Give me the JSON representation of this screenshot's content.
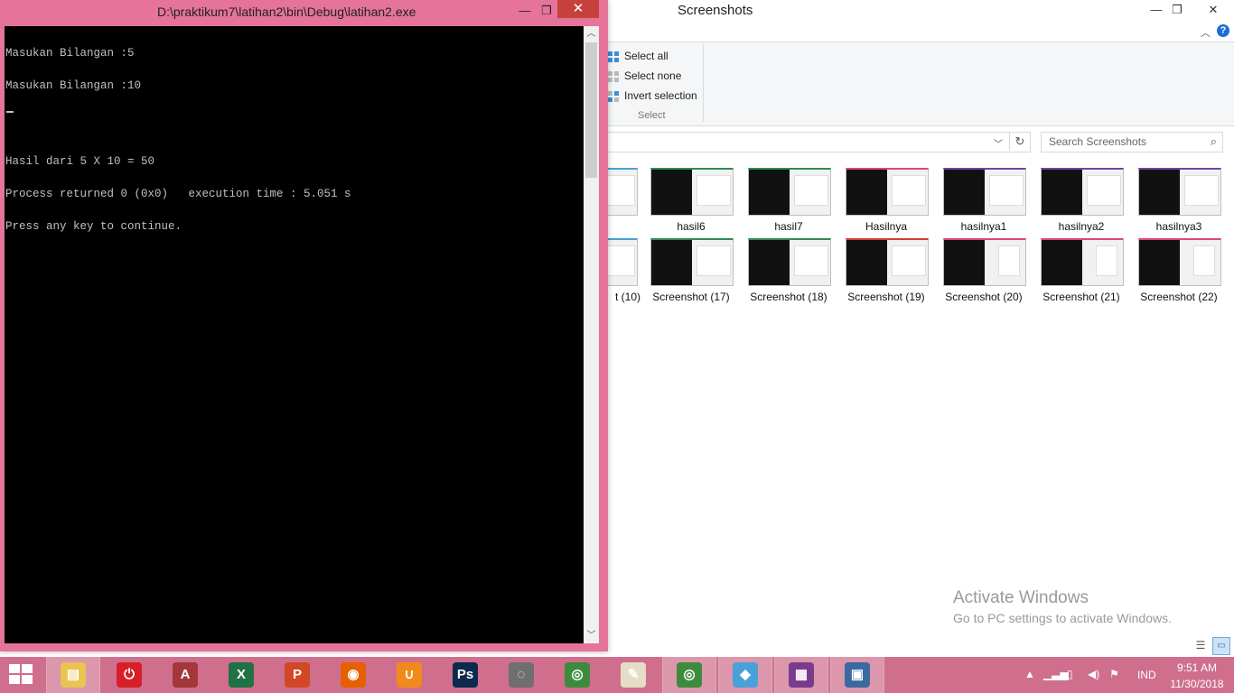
{
  "console": {
    "title": "D:\\praktikum7\\latihan2\\bin\\Debug\\latihan2.exe",
    "minimize": "—",
    "maximize": "❐",
    "close": "✕",
    "lines": [
      "Masukan Bilangan :5",
      "Masukan Bilangan :10",
      "",
      "",
      "Hasil dari 5 X 10 = 50",
      "Process returned 0 (0x0)   execution time : 5.051 s",
      "Press any key to continue."
    ]
  },
  "explorer": {
    "title": "Screenshots",
    "ribbon": {
      "select_all": "Select all",
      "select_none": "Select none",
      "invert_selection": "Invert selection",
      "group_label": "Select"
    },
    "search_placeholder": "Search Screenshots",
    "tiles_row1": [
      "",
      "hasil6",
      "hasil7",
      "Hasilnya",
      "hasilnya1",
      "hasilnya2",
      "hasilnya3"
    ],
    "tiles_row2": [
      "t (10)",
      "Screenshot (17)",
      "Screenshot (18)",
      "Screenshot (19)",
      "Screenshot (20)",
      "Screenshot (21)",
      "Screenshot (22)"
    ],
    "watermark_title": "Activate Windows",
    "watermark_sub": "Go to PC settings to activate Windows."
  },
  "taskbar": {
    "apps": [
      {
        "name": "file-explorer",
        "color": "#e8c451",
        "glyph": "▤"
      },
      {
        "name": "power",
        "color": "#d81e27",
        "glyph": "⏻"
      },
      {
        "name": "access",
        "color": "#a4373a",
        "glyph": "A"
      },
      {
        "name": "excel",
        "color": "#207245",
        "glyph": "X"
      },
      {
        "name": "powerpoint",
        "color": "#d24726",
        "glyph": "P"
      },
      {
        "name": "firefox",
        "color": "#e66000",
        "glyph": "◉"
      },
      {
        "name": "uc-browser",
        "color": "#f08a1c",
        "glyph": "∪"
      },
      {
        "name": "photoshop",
        "color": "#0b2a4d",
        "glyph": "Ps"
      },
      {
        "name": "codeblocks",
        "color": "#6f6f6f",
        "glyph": "◌"
      },
      {
        "name": "chrome",
        "color": "#3d8b3d",
        "glyph": "◎"
      },
      {
        "name": "paint",
        "color": "#e6ddc6",
        "glyph": "✎"
      },
      {
        "name": "chrome-2",
        "color": "#3d8b3d",
        "glyph": "◎"
      },
      {
        "name": "app-diamond",
        "color": "#4aa0d9",
        "glyph": "◆"
      },
      {
        "name": "winrar",
        "color": "#7a3b8f",
        "glyph": "▦"
      },
      {
        "name": "console-app",
        "color": "#3c6aa0",
        "glyph": "▣"
      }
    ],
    "language": "IND",
    "time": "9:51 AM",
    "date": "11/30/2018"
  }
}
